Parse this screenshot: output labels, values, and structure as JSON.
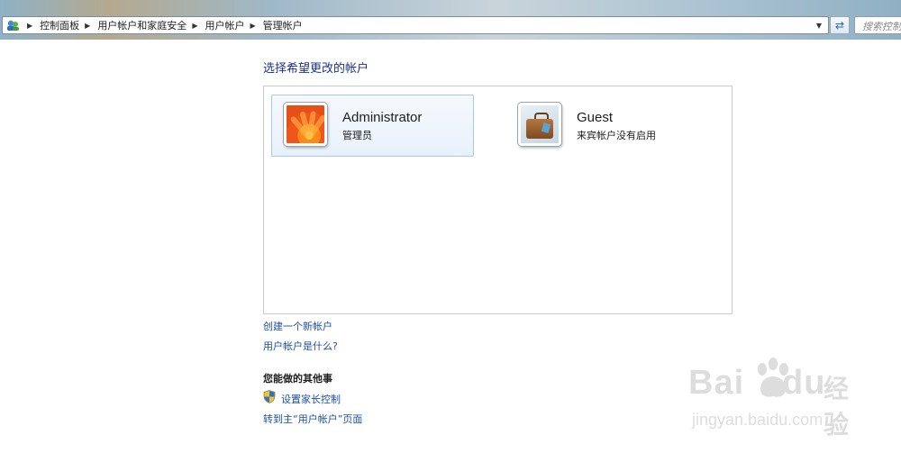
{
  "address_bar": {
    "breadcrumbs": [
      "控制面板",
      "用户帐户和家庭安全",
      "用户帐户",
      "管理帐户"
    ],
    "search_placeholder": "搜索控制"
  },
  "main": {
    "title": "选择希望更改的帐户",
    "accounts": [
      {
        "name": "Administrator",
        "subtitle": "管理员",
        "avatar": "orange-flower",
        "selected": true
      },
      {
        "name": "Guest",
        "subtitle": "来宾帐户没有启用",
        "avatar": "suitcase",
        "selected": false
      }
    ],
    "links": {
      "create_account": "创建一个新帐户",
      "what_is_account": "用户帐户是什么?"
    },
    "other_tasks": {
      "heading": "您能做的其他事",
      "parental_controls": "设置家长控制",
      "goto_main": "转到主“用户帐户”页面"
    }
  },
  "watermark": {
    "brand": "Bai",
    "brand2": "du",
    "product": "经验",
    "url": "jingyan.baidu.com"
  },
  "colors": {
    "link": "#1e50a0",
    "title": "#1e3287",
    "panel_border": "#c7cbd1",
    "selected_bg": "#e8f1fb"
  }
}
